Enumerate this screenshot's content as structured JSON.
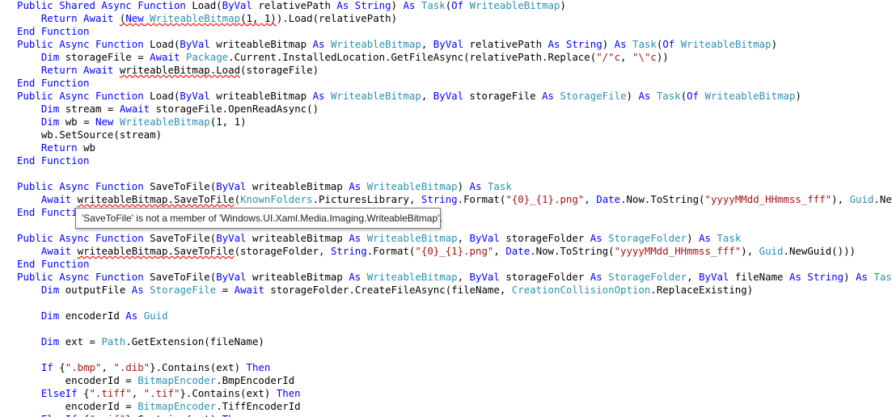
{
  "editor": {
    "colors": {
      "keyword": "#0000ff",
      "type": "#2b91af",
      "string": "#a31515",
      "error": "#ff2020"
    },
    "lines": [
      [
        [
          "k",
          "Public Shared Async Function"
        ],
        [
          "p",
          " Load("
        ],
        [
          "k",
          "ByVal"
        ],
        [
          "p",
          " relativePath "
        ],
        [
          "k",
          "As"
        ],
        [
          "p",
          " "
        ],
        [
          "k",
          "String"
        ],
        [
          "p",
          ") "
        ],
        [
          "k",
          "As"
        ],
        [
          "p",
          " "
        ],
        [
          "t",
          "Task"
        ],
        [
          "p",
          "("
        ],
        [
          "k",
          "Of"
        ],
        [
          "p",
          " "
        ],
        [
          "t",
          "WriteableBitmap"
        ],
        [
          "p",
          ")"
        ]
      ],
      [
        [
          "p",
          "    "
        ],
        [
          "k",
          "Return Await"
        ],
        [
          "p",
          " "
        ],
        [
          "e",
          "("
        ],
        [
          "ek",
          "New"
        ],
        [
          "e",
          " "
        ],
        [
          "et",
          "WriteableBitmap"
        ],
        [
          "e",
          "(1, 1)"
        ],
        [
          "p",
          ").Load(relativePath)"
        ]
      ],
      [
        [
          "k",
          "End Function"
        ]
      ],
      [
        [
          "k",
          "Public Async Function"
        ],
        [
          "p",
          " Load("
        ],
        [
          "k",
          "ByVal"
        ],
        [
          "p",
          " writeableBitmap "
        ],
        [
          "k",
          "As"
        ],
        [
          "p",
          " "
        ],
        [
          "t",
          "WriteableBitmap"
        ],
        [
          "p",
          ", "
        ],
        [
          "k",
          "ByVal"
        ],
        [
          "p",
          " relativePath "
        ],
        [
          "k",
          "As"
        ],
        [
          "p",
          " "
        ],
        [
          "k",
          "String"
        ],
        [
          "p",
          ") "
        ],
        [
          "k",
          "As"
        ],
        [
          "p",
          " "
        ],
        [
          "t",
          "Task"
        ],
        [
          "p",
          "("
        ],
        [
          "k",
          "Of"
        ],
        [
          "p",
          " "
        ],
        [
          "t",
          "WriteableBitmap"
        ],
        [
          "p",
          ")"
        ]
      ],
      [
        [
          "p",
          "    "
        ],
        [
          "k",
          "Dim"
        ],
        [
          "p",
          " storageFile = "
        ],
        [
          "k",
          "Await"
        ],
        [
          "p",
          " "
        ],
        [
          "t",
          "Package"
        ],
        [
          "p",
          ".Current.InstalledLocation.GetFileAsync(relativePath.Replace("
        ],
        [
          "s",
          "\"/\"c"
        ],
        [
          "p",
          ", "
        ],
        [
          "s",
          "\"\\\"c"
        ],
        [
          "p",
          "))"
        ]
      ],
      [
        [
          "p",
          "    "
        ],
        [
          "k",
          "Return Await"
        ],
        [
          "p",
          " "
        ],
        [
          "e",
          "writeableBitmap.Load"
        ],
        [
          "p",
          "(storageFile)"
        ]
      ],
      [
        [
          "k",
          "End Function"
        ]
      ],
      [
        [
          "k",
          "Public Async Function"
        ],
        [
          "p",
          " Load("
        ],
        [
          "k",
          "ByVal"
        ],
        [
          "p",
          " writeableBitmap "
        ],
        [
          "k",
          "As"
        ],
        [
          "p",
          " "
        ],
        [
          "t",
          "WriteableBitmap"
        ],
        [
          "p",
          ", "
        ],
        [
          "k",
          "ByVal"
        ],
        [
          "p",
          " storageFile "
        ],
        [
          "k",
          "As"
        ],
        [
          "p",
          " "
        ],
        [
          "t",
          "StorageFile"
        ],
        [
          "p",
          ") "
        ],
        [
          "k",
          "As"
        ],
        [
          "p",
          " "
        ],
        [
          "t",
          "Task"
        ],
        [
          "p",
          "("
        ],
        [
          "k",
          "Of"
        ],
        [
          "p",
          " "
        ],
        [
          "t",
          "WriteableBitmap"
        ],
        [
          "p",
          ")"
        ]
      ],
      [
        [
          "p",
          "    "
        ],
        [
          "k",
          "Dim"
        ],
        [
          "p",
          " stream = "
        ],
        [
          "k",
          "Await"
        ],
        [
          "p",
          " storageFile.OpenReadAsync()"
        ]
      ],
      [
        [
          "p",
          "    "
        ],
        [
          "k",
          "Dim"
        ],
        [
          "p",
          " wb = "
        ],
        [
          "k",
          "New"
        ],
        [
          "p",
          " "
        ],
        [
          "t",
          "WriteableBitmap"
        ],
        [
          "p",
          "(1, 1)"
        ]
      ],
      [
        [
          "p",
          "    wb.SetSource(stream)"
        ]
      ],
      [
        [
          "p",
          "    "
        ],
        [
          "k",
          "Return"
        ],
        [
          "p",
          " wb"
        ]
      ],
      [
        [
          "k",
          "End Function"
        ]
      ],
      [],
      [
        [
          "k",
          "Public Async Function"
        ],
        [
          "p",
          " SaveToFile("
        ],
        [
          "k",
          "ByVal"
        ],
        [
          "p",
          " writeableBitmap "
        ],
        [
          "k",
          "As"
        ],
        [
          "p",
          " "
        ],
        [
          "t",
          "WriteableBitmap"
        ],
        [
          "p",
          ") "
        ],
        [
          "k",
          "As"
        ],
        [
          "p",
          " "
        ],
        [
          "t",
          "Task"
        ]
      ],
      [
        [
          "p",
          "    "
        ],
        [
          "k",
          "Await"
        ],
        [
          "p",
          " "
        ],
        [
          "e",
          "writeableBitmap.SaveToFile"
        ],
        [
          "p",
          "("
        ],
        [
          "t",
          "KnownFolders"
        ],
        [
          "p",
          ".PicturesLibrary, "
        ],
        [
          "k",
          "String"
        ],
        [
          "p",
          ".Format("
        ],
        [
          "s",
          "\"{0}_{1}.png\""
        ],
        [
          "p",
          ", "
        ],
        [
          "k",
          "Date"
        ],
        [
          "p",
          ".Now.ToString("
        ],
        [
          "s",
          "\"yyyyMMdd_HHmmss_fff\""
        ],
        [
          "p",
          "), "
        ],
        [
          "t",
          "Guid"
        ],
        [
          "p",
          ".NewGuid()))"
        ]
      ],
      [
        [
          "k",
          "End Functi"
        ]
      ],
      [],
      [
        [
          "k",
          "Public Async Function"
        ],
        [
          "p",
          " SaveToFile("
        ],
        [
          "k",
          "ByVal"
        ],
        [
          "p",
          " writeableBitmap "
        ],
        [
          "k",
          "As"
        ],
        [
          "p",
          " "
        ],
        [
          "t",
          "WriteableBitmap"
        ],
        [
          "p",
          ", "
        ],
        [
          "k",
          "ByVal"
        ],
        [
          "p",
          " storageFolder "
        ],
        [
          "k",
          "As"
        ],
        [
          "p",
          " "
        ],
        [
          "t",
          "StorageFolder"
        ],
        [
          "p",
          ") "
        ],
        [
          "k",
          "As"
        ],
        [
          "p",
          " "
        ],
        [
          "t",
          "Task"
        ]
      ],
      [
        [
          "p",
          "    "
        ],
        [
          "k",
          "Await"
        ],
        [
          "p",
          " "
        ],
        [
          "e",
          "writeableBitmap.SaveToFile"
        ],
        [
          "p",
          "(storageFolder, "
        ],
        [
          "k",
          "String"
        ],
        [
          "p",
          ".Format("
        ],
        [
          "s",
          "\"{0}_{1}.png\""
        ],
        [
          "p",
          ", "
        ],
        [
          "k",
          "Date"
        ],
        [
          "p",
          ".Now.ToString("
        ],
        [
          "s",
          "\"yyyyMMdd_HHmmss_fff\""
        ],
        [
          "p",
          "), "
        ],
        [
          "t",
          "Guid"
        ],
        [
          "p",
          ".NewGuid()))"
        ]
      ],
      [
        [
          "k",
          "End Function"
        ]
      ],
      [
        [
          "k",
          "Public Async Function"
        ],
        [
          "p",
          " SaveToFile("
        ],
        [
          "k",
          "ByVal"
        ],
        [
          "p",
          " writeableBitmap "
        ],
        [
          "k",
          "As"
        ],
        [
          "p",
          " "
        ],
        [
          "t",
          "WriteableBitmap"
        ],
        [
          "p",
          ", "
        ],
        [
          "k",
          "ByVal"
        ],
        [
          "p",
          " storageFolder "
        ],
        [
          "k",
          "As"
        ],
        [
          "p",
          " "
        ],
        [
          "t",
          "StorageFolder"
        ],
        [
          "p",
          ", "
        ],
        [
          "k",
          "ByVal"
        ],
        [
          "p",
          " fileName "
        ],
        [
          "k",
          "As"
        ],
        [
          "p",
          " "
        ],
        [
          "k",
          "String"
        ],
        [
          "p",
          ") "
        ],
        [
          "k",
          "As"
        ],
        [
          "p",
          " "
        ],
        [
          "t",
          "Task"
        ]
      ],
      [
        [
          "p",
          "    "
        ],
        [
          "k",
          "Dim"
        ],
        [
          "p",
          " outputFile "
        ],
        [
          "k",
          "As"
        ],
        [
          "p",
          " "
        ],
        [
          "t",
          "StorageFile"
        ],
        [
          "p",
          " = "
        ],
        [
          "k",
          "Await"
        ],
        [
          "p",
          " storageFolder.CreateFileAsync(fileName, "
        ],
        [
          "t",
          "CreationCollisionOption"
        ],
        [
          "p",
          ".ReplaceExisting)"
        ]
      ],
      [],
      [
        [
          "p",
          "    "
        ],
        [
          "k",
          "Dim"
        ],
        [
          "p",
          " encoderId "
        ],
        [
          "k",
          "As"
        ],
        [
          "p",
          " "
        ],
        [
          "t",
          "Guid"
        ]
      ],
      [],
      [
        [
          "p",
          "    "
        ],
        [
          "k",
          "Dim"
        ],
        [
          "p",
          " ext = "
        ],
        [
          "t",
          "Path"
        ],
        [
          "p",
          ".GetExtension(fileName)"
        ]
      ],
      [],
      [
        [
          "p",
          "    "
        ],
        [
          "k",
          "If"
        ],
        [
          "p",
          " {"
        ],
        [
          "s",
          "\".bmp\""
        ],
        [
          "p",
          ", "
        ],
        [
          "s",
          "\".dib\""
        ],
        [
          "p",
          "}.Contains(ext) "
        ],
        [
          "k",
          "Then"
        ]
      ],
      [
        [
          "p",
          "        encoderId = "
        ],
        [
          "t",
          "BitmapEncoder"
        ],
        [
          "p",
          ".BmpEncoderId"
        ]
      ],
      [
        [
          "p",
          "    "
        ],
        [
          "k",
          "ElseIf"
        ],
        [
          "p",
          " {"
        ],
        [
          "s",
          "\".tiff\""
        ],
        [
          "p",
          ", "
        ],
        [
          "s",
          "\".tif\""
        ],
        [
          "p",
          "}.Contains(ext) "
        ],
        [
          "k",
          "Then"
        ]
      ],
      [
        [
          "p",
          "        encoderId = "
        ],
        [
          "t",
          "BitmapEncoder"
        ],
        [
          "p",
          ".TiffEncoderId"
        ]
      ],
      [
        [
          "p",
          "    "
        ],
        [
          "k",
          "ElseIf"
        ],
        [
          "p",
          " {"
        ],
        [
          "s",
          "\".gif\""
        ],
        [
          "p",
          "}.Contains(ext) "
        ],
        [
          "k",
          "Then"
        ]
      ]
    ]
  },
  "tooltip": {
    "text": "'SaveToFile' is not a member of 'Windows.UI.Xaml.Media.Imaging.WriteableBitmap'."
  }
}
